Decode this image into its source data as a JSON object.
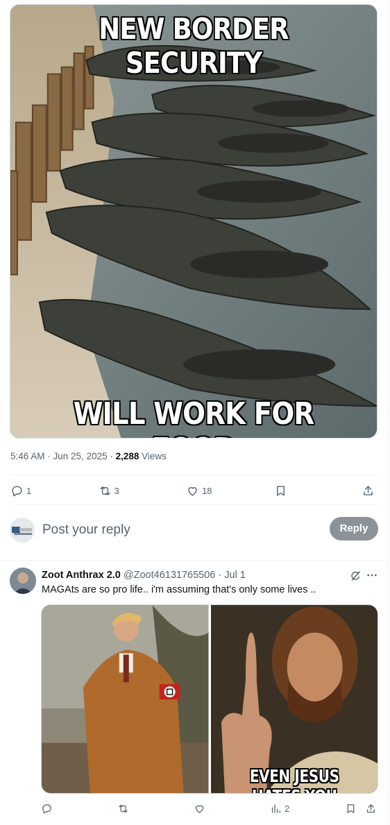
{
  "main_post": {
    "meme": {
      "top_caption": "NEW BORDER SECURITY",
      "bottom_caption": "WILL WORK FOR FOOD"
    },
    "time": "5:46 AM",
    "sep1": " · ",
    "date": "Jun 25, 2025",
    "sep2": " · ",
    "views_count": "2,288",
    "views_label": " Views",
    "actions": {
      "replies": "1",
      "reposts": "3",
      "likes": "18"
    }
  },
  "reply_box": {
    "placeholder": "Post your reply",
    "button_label": "Reply"
  },
  "reply_post": {
    "display_name": "Zoot Anthrax 2.0",
    "handle": "@Zoot46131765506",
    "separator": " · ",
    "date": "Jul 1",
    "text": "MAGAts are so pro life.. i'm assuming that's only some lives ..",
    "media_caption": "EVEN JESUS HATES YOU",
    "actions": {
      "views": "2"
    }
  },
  "icons": {
    "reply": "reply-icon",
    "repost": "repost-icon",
    "like": "heart-icon",
    "bookmark": "bookmark-icon",
    "share": "share-icon",
    "views": "views-icon",
    "grok": "grok-icon",
    "more": "more-icon"
  }
}
